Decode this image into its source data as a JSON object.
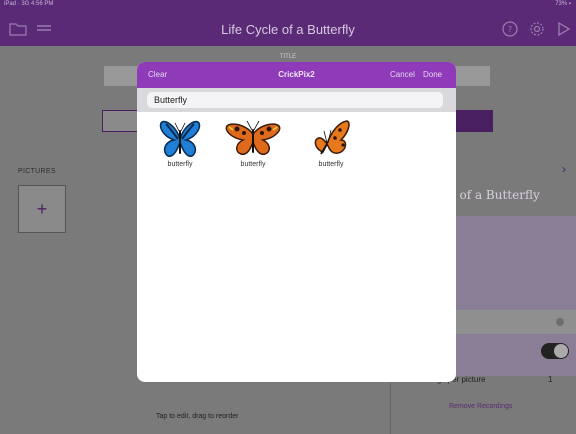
{
  "status_bar": {
    "left": "iPad · 3G 4:56 PM",
    "right": "73% ▪"
  },
  "nav": {
    "title": "Life Cycle of a Butterfly"
  },
  "background": {
    "title_label": "TITLE",
    "pictures_label": "PICTURES",
    "add_label": "+",
    "panel_title": "cle of a Butterfly",
    "recordings_label": "Recordings per picture",
    "recordings_count": "1",
    "remove_recordings": "Remove Recordings",
    "hint": "Tap to edit, drag to reorder"
  },
  "picker": {
    "title": "CrickPix2",
    "clear": "Clear",
    "cancel": "Cancel",
    "done": "Done",
    "search_value": "Butterfly",
    "results": [
      {
        "label": "butterfly",
        "icon": "blue-butterfly-icon"
      },
      {
        "label": "butterfly",
        "icon": "tortoiseshell-butterfly-icon"
      },
      {
        "label": "butterfly",
        "icon": "orange-butterfly-icon"
      }
    ]
  },
  "colors": {
    "accent": "#8e3ab9",
    "nav": "#5a2a76"
  }
}
